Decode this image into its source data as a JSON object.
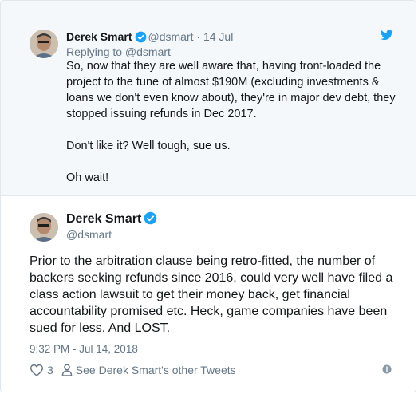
{
  "parent_tweet": {
    "author_name": "Derek Smart",
    "handle": "@dsmart",
    "separator": "·",
    "date": "14 Jul",
    "replying_to": "Replying to @dsmart",
    "paragraphs": [
      "So, now that they are well aware that, having front-loaded the project to the tune of almost $190M (excluding investments & loans we don't even know about), they're in major dev debt, they stopped issuing refunds in Dec 2017.",
      "Don't like it? Well tough, sue us.",
      "Oh wait!"
    ]
  },
  "main_tweet": {
    "author_name": "Derek Smart",
    "handle": "@dsmart",
    "text": "Prior to the arbitration clause being retro-fitted, the number of backers seeking refunds since 2016, could very well have filed a class action lawsuit to get their money back, get financial accountability promised etc. Heck, game companies have been sued for less. And LOST.",
    "timestamp": "9:32 PM - Jul 14, 2018",
    "like_count": "3",
    "other_tweets_link": "See Derek Smart's other Tweets"
  },
  "icons": {
    "verified": "verified-badge-icon",
    "brand": "twitter-bird-icon",
    "like": "heart-icon",
    "profile": "person-icon",
    "info": "info-icon"
  },
  "colors": {
    "verified_blue": "#1da1f2",
    "muted_text": "#657786",
    "parent_background": "#f5f8fa"
  }
}
